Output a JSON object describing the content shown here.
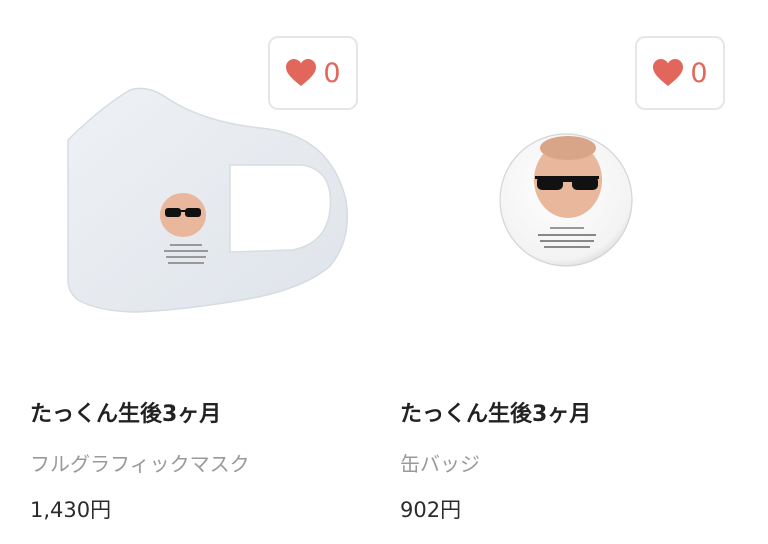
{
  "products": [
    {
      "title": "たっくん生後3ヶ月",
      "type": "フルグラフィックマスク",
      "price": "1,430円",
      "favorites": "0",
      "image": "mask-product-image"
    },
    {
      "title": "たっくん生後3ヶ月",
      "type": "缶バッジ",
      "price": "902円",
      "favorites": "0",
      "image": "badge-product-image"
    }
  ],
  "colors": {
    "heart": "#e1675c",
    "border": "#e6e6e6",
    "subtitle": "#9a9a9a"
  }
}
